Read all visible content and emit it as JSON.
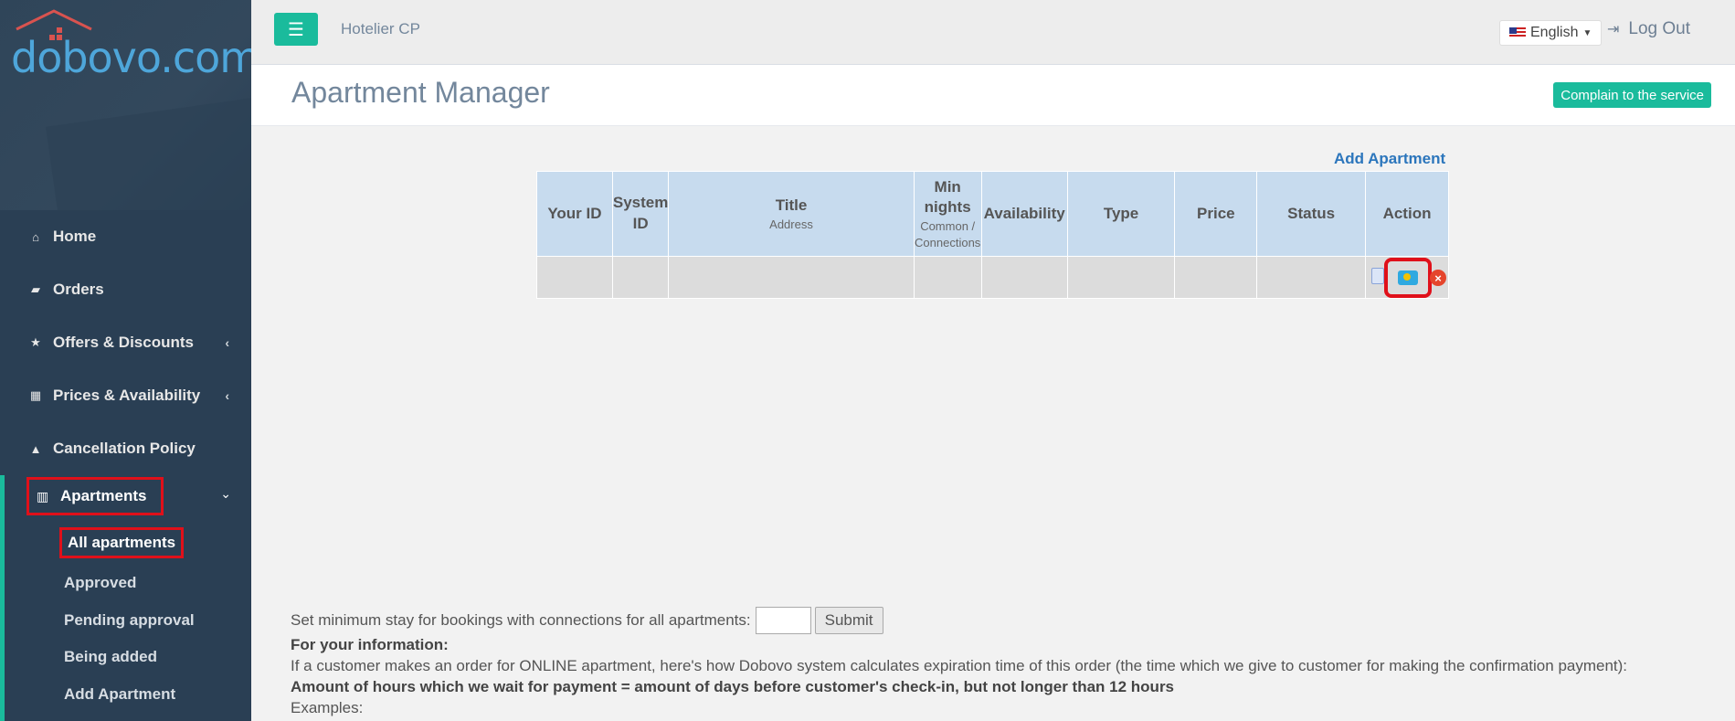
{
  "sidebar": {
    "logo_text": "dobovo.com",
    "items": [
      {
        "label": "Home",
        "icon": "home-icon"
      },
      {
        "label": "Orders",
        "icon": "book-icon"
      },
      {
        "label": "Offers & Discounts",
        "icon": "star-icon"
      },
      {
        "label": "Prices & Availability",
        "icon": "calendar-icon"
      },
      {
        "label": "Cancellation Policy",
        "icon": "warning-icon"
      }
    ],
    "apartments": {
      "label": "Apartments",
      "icon": "building-icon",
      "sub_items": [
        "All apartments",
        "Approved",
        "Pending approval",
        "Being added",
        "Add Apartment"
      ]
    }
  },
  "topnav": {
    "brand": "Hotelier CP",
    "language": "English",
    "logout": "Log Out"
  },
  "page": {
    "title": "Apartment Manager",
    "complain_button": "Complain to the service"
  },
  "table": {
    "add_link": "Add Apartment",
    "headers": {
      "your_id": "Your ID",
      "system_id": "System ID",
      "title": "Title",
      "title_sub": "Address",
      "min_nights": "Min nights",
      "min_nights_sub": "Common / Connections",
      "availability": "Availability",
      "type": "Type",
      "price": "Price",
      "status": "Status",
      "action": "Action"
    }
  },
  "bottom": {
    "min_stay_label": "Set minimum stay for bookings with connections for all apartments:",
    "min_stay_value": "",
    "submit": "Submit",
    "info_heading": "For your information:",
    "info_text": "If a customer makes an order for ONLINE apartment, here's how Dobovo system calculates expiration time of this order (the time which we give to customer for making the confirmation payment):",
    "rule": "Amount of hours which we wait for payment = amount of days before customer's check-in, but not longer than 12 hours",
    "examples": "Examples:"
  },
  "colors": {
    "sidebar_bg": "#2a3f54",
    "accent_green": "#1abb9c",
    "header_blue": "#c7dbee",
    "highlight_red": "#e0101a",
    "link_blue": "#2c76bc"
  }
}
